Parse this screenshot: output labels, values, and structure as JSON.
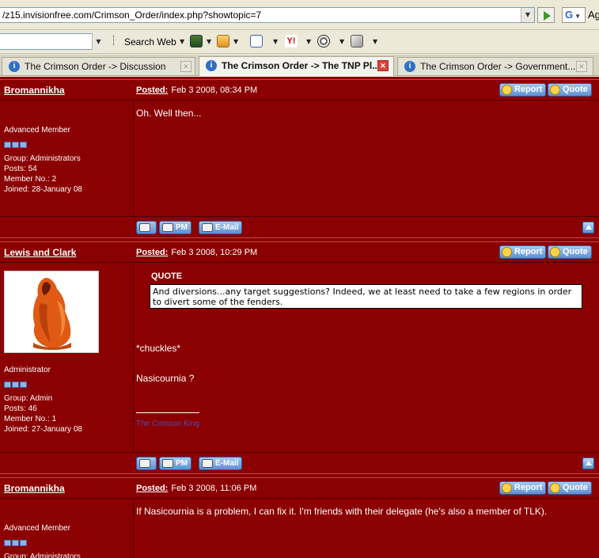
{
  "browser": {
    "url": "/z15.invisionfree.com/Crimson_Order/index.php?showtopic=7",
    "search_button": "Search Web",
    "search_engine_partial": "Ag"
  },
  "tabs": [
    {
      "label": "The Crimson Order -> Discussion",
      "active": false
    },
    {
      "label": "The Crimson Order -> The TNP Pl...",
      "active": true
    },
    {
      "label": "The Crimson Order -> Government...",
      "active": false
    }
  ],
  "forum": {
    "posted_label": "Posted:",
    "report_label": "Report",
    "quote_label": "Quote",
    "pm_label": "PM",
    "email_label": "E-Mail",
    "posts": [
      {
        "author": "Bromannikha",
        "date": "Feb 3 2008, 08:34 PM",
        "rank": "Advanced Member",
        "group": "Group: Administrators",
        "posts": "Posts: 54",
        "member_no": "Member No.: 2",
        "joined": "Joined: 28-January 08",
        "body": "Oh. Well then..."
      },
      {
        "author": "Lewis and Clark",
        "date": "Feb 3 2008, 10:29 PM",
        "rank": "Administrator",
        "group": "Group: Admin",
        "posts": "Posts: 46",
        "member_no": "Member No.: 1",
        "joined": "Joined: 27-January 08",
        "quote_title": "QUOTE",
        "quote_text": "And diversions...any target suggestions? Indeed, we at least need to take a few regions in order to divert some of the fenders.",
        "line1": "*chuckles*",
        "line2": "Nasicournia ?",
        "signature": "The Crimson King"
      },
      {
        "author": "Bromannikha",
        "date": "Feb 3 2008, 11:06 PM",
        "rank": "Advanced Member",
        "group": "Group: Administrators",
        "body": "If Nasicournia is a problem, I can fix it. I'm friends with their delegate (he's also a member of TLK)."
      }
    ]
  },
  "colors": {
    "forum_background": "#8b0000",
    "signature_link": "#4f4fb8",
    "button_blue": "#5b8fd3"
  }
}
